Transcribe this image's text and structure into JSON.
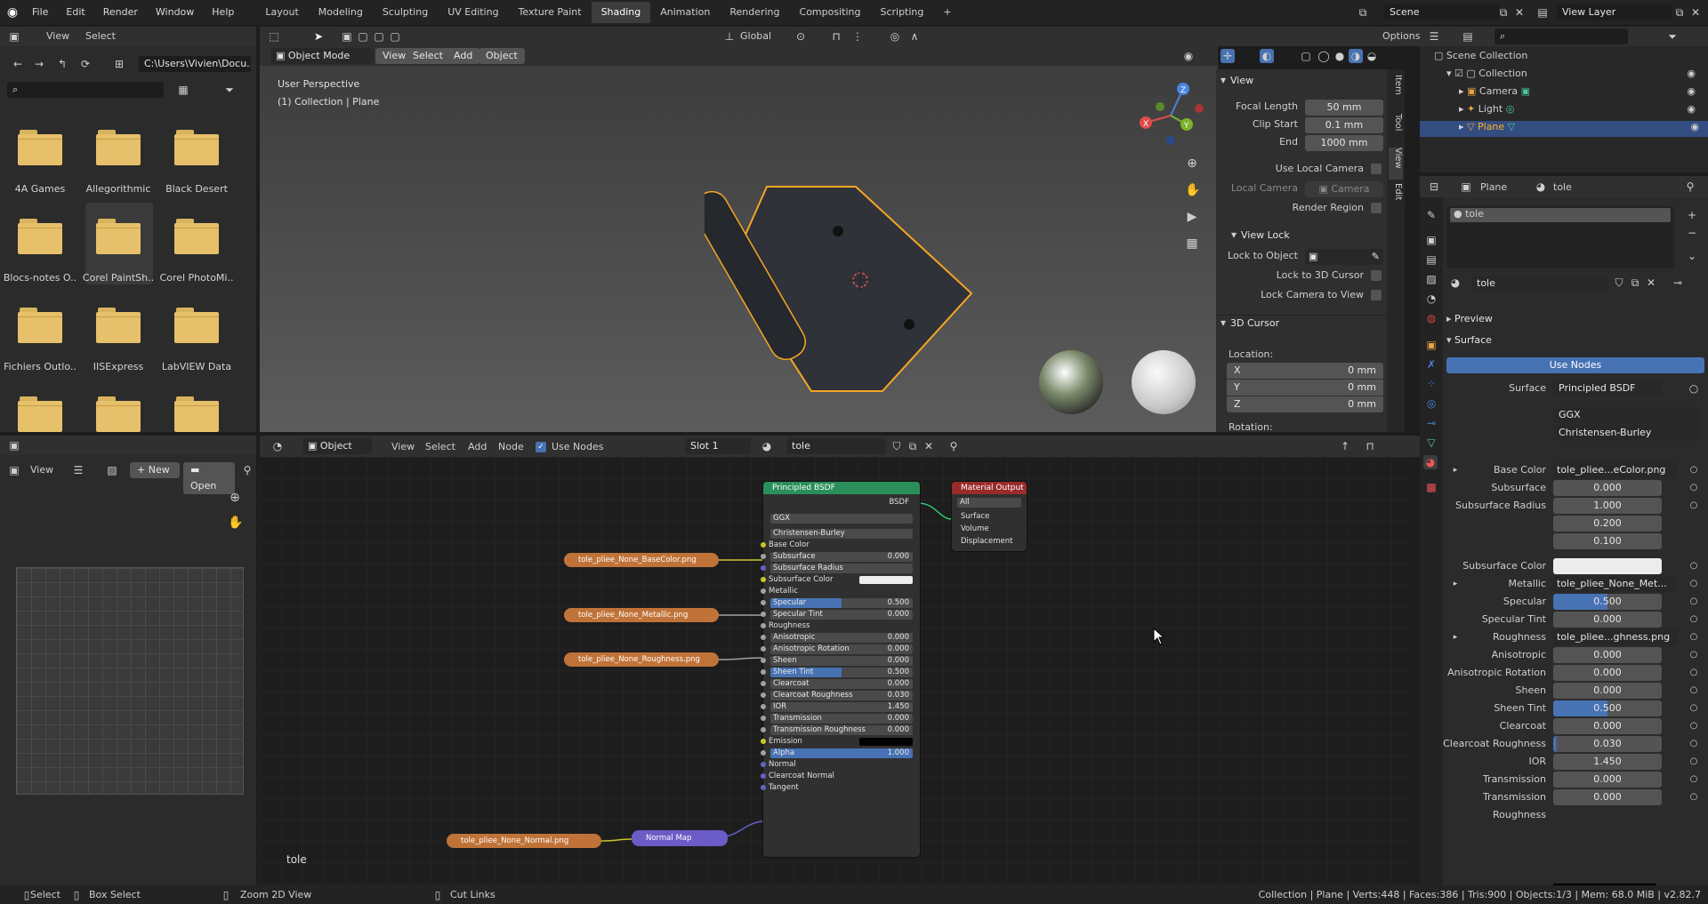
{
  "topbar": {
    "menus": [
      "File",
      "Edit",
      "Render",
      "Window",
      "Help"
    ],
    "workspaces": [
      "Layout",
      "Modeling",
      "Sculpting",
      "UV Editing",
      "Texture Paint",
      "Shading",
      "Animation",
      "Rendering",
      "Compositing",
      "Scripting"
    ],
    "active_workspace": "Shading",
    "scene": "Scene",
    "view_layer": "View Layer"
  },
  "filebrowser": {
    "menu": [
      "View",
      "Select"
    ],
    "path": "C:\\Users\\Vivien\\Docu...",
    "folders": [
      "4A Games",
      "Allegorithmic",
      "Black Desert",
      "Blocs-notes O..",
      "Corel PaintSh..",
      "Corel PhotoMi..",
      "Fichiers Outlo..",
      "IISExpress",
      "LabVIEW Data"
    ]
  },
  "imageeditor": {
    "view": "View",
    "new": "New",
    "open": "Open"
  },
  "viewport": {
    "mode": "Object Mode",
    "menu": [
      "View",
      "Select",
      "Add",
      "Object"
    ],
    "transform": "Global",
    "options": "Options",
    "info1": "User Perspective",
    "info2": "(1) Collection | Plane",
    "npanel": {
      "view_title": "View",
      "focal_length_label": "Focal Length",
      "focal_length": "50 mm",
      "clip_start_label": "Clip Start",
      "clip_start": "0.1 mm",
      "end_label": "End",
      "end": "1000 mm",
      "use_local_camera": "Use Local Camera",
      "local_camera_label": "Local Camera",
      "local_camera": "Camera",
      "render_region": "Render Region",
      "view_lock_title": "View Lock",
      "lock_to_object": "Lock to Object",
      "lock_to_3d_cursor": "Lock to 3D Cursor",
      "lock_camera_to_view": "Lock Camera to View",
      "cursor_title": "3D Cursor",
      "location": "Location:",
      "x_label": "X",
      "x": "0 mm",
      "y_label": "Y",
      "y": "0 mm",
      "z_label": "Z",
      "z": "0 mm",
      "rotation": "Rotation:",
      "tabs": [
        "Item",
        "Tool",
        "View",
        "Edit"
      ]
    }
  },
  "nodeeditor": {
    "editor_type": "Object",
    "menu": [
      "View",
      "Select",
      "Add",
      "Node"
    ],
    "use_nodes": "Use Nodes",
    "slot": "Slot 1",
    "material": "tole",
    "footer_label": "tole",
    "bsdf": {
      "title": "Principled BSDF",
      "output": "BSDF",
      "dist": "GGX",
      "sss": "Christensen-Burley",
      "rows": [
        {
          "label": "Base Color",
          "value": ""
        },
        {
          "label": "Subsurface",
          "value": "0.000"
        },
        {
          "label": "Subsurface Radius",
          "value": ""
        },
        {
          "label": "Subsurface Color",
          "value": ""
        },
        {
          "label": "Metallic",
          "value": ""
        },
        {
          "label": "Specular",
          "value": "0.500"
        },
        {
          "label": "Specular Tint",
          "value": "0.000"
        },
        {
          "label": "Roughness",
          "value": ""
        },
        {
          "label": "Anisotropic",
          "value": "0.000"
        },
        {
          "label": "Anisotropic Rotation",
          "value": "0.000"
        },
        {
          "label": "Sheen",
          "value": "0.000"
        },
        {
          "label": "Sheen Tint",
          "value": "0.500"
        },
        {
          "label": "Clearcoat",
          "value": "0.000"
        },
        {
          "label": "Clearcoat Roughness",
          "value": "0.030"
        },
        {
          "label": "IOR",
          "value": "1.450"
        },
        {
          "label": "Transmission",
          "value": "0.000"
        },
        {
          "label": "Transmission Roughness",
          "value": "0.000"
        },
        {
          "label": "Emission",
          "value": ""
        },
        {
          "label": "Alpha",
          "value": "1.000"
        },
        {
          "label": "Normal",
          "value": ""
        },
        {
          "label": "Clearcoat Normal",
          "value": ""
        },
        {
          "label": "Tangent",
          "value": ""
        }
      ]
    },
    "output_node": {
      "title": "Material Output",
      "target": "All",
      "sockets": [
        "Surface",
        "Volume",
        "Displacement"
      ]
    },
    "textures": [
      "tole_pliee_None_BaseColor.png",
      "tole_pliee_None_Metallic.png",
      "tole_pliee_None_Roughness.png",
      "tole_pliee_None_Normal.png"
    ],
    "normal_map": "Normal Map"
  },
  "outliner": {
    "scene_collection": "Scene Collection",
    "items": [
      "Collection",
      "Camera",
      "Light",
      "Plane"
    ]
  },
  "properties": {
    "object": "Plane",
    "material": "tole",
    "slot_name": "tole",
    "mat_field": "tole",
    "preview": "Preview",
    "surface_panel": "Surface",
    "use_nodes": "Use Nodes",
    "surface_label": "Surface",
    "surface_value": "Principled BSDF",
    "dist": "GGX",
    "sss": "Christensen-Burley",
    "rows": [
      {
        "label": "Base Color",
        "value": "tole_pliee...eColor.png"
      },
      {
        "label": "Subsurface",
        "value": "0.000"
      },
      {
        "label": "Subsurface Radius",
        "value": "1.000"
      },
      {
        "label": "",
        "value": "0.200"
      },
      {
        "label": "",
        "value": "0.100"
      },
      {
        "label": "Subsurface Color",
        "value": ""
      },
      {
        "label": "Metallic",
        "value": "tole_pliee_None_Met..."
      },
      {
        "label": "Specular",
        "value": "0.500"
      },
      {
        "label": "Specular Tint",
        "value": "0.000"
      },
      {
        "label": "Roughness",
        "value": "tole_pliee...ghness.png"
      },
      {
        "label": "Anisotropic",
        "value": "0.000"
      },
      {
        "label": "Anisotropic Rotation",
        "value": "0.000"
      },
      {
        "label": "Sheen",
        "value": "0.000"
      },
      {
        "label": "Sheen Tint",
        "value": "0.500"
      },
      {
        "label": "Clearcoat",
        "value": "0.000"
      },
      {
        "label": "Clearcoat Roughness",
        "value": "0.030"
      },
      {
        "label": "IOR",
        "value": "1.450"
      },
      {
        "label": "Transmission",
        "value": "0.000"
      },
      {
        "label": "Transmission Roughness",
        "value": "0.000"
      }
    ]
  },
  "statusbar": {
    "select": "Select",
    "box_select": "Box Select",
    "zoom": "Zoom 2D View",
    "cut_links": "Cut Links",
    "stats": "Collection | Plane | Verts:448 | Faces:386 | Tris:900 | Objects:1/3 | Mem: 68.0 MiB | v2.82.7"
  }
}
